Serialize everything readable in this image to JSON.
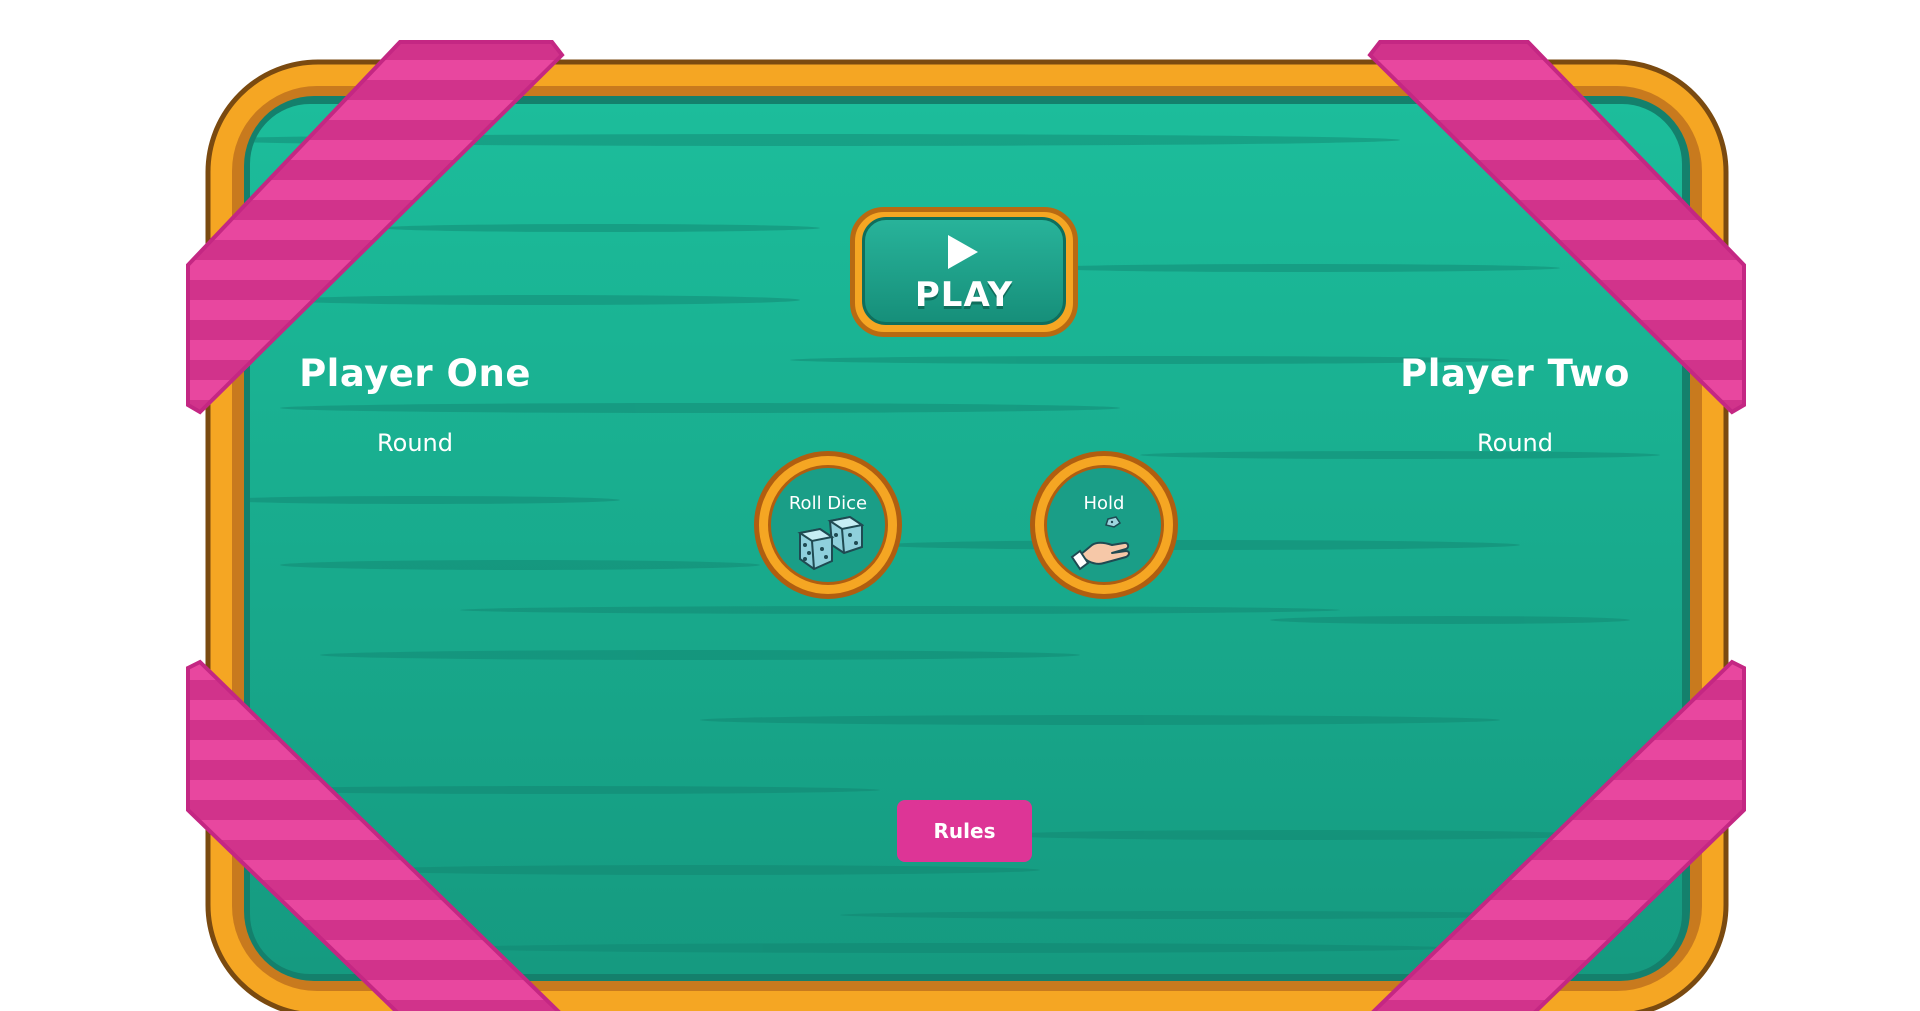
{
  "players": [
    {
      "name": "Player One",
      "round_label": "Round"
    },
    {
      "name": "Player Two",
      "round_label": "Round"
    }
  ],
  "controls": {
    "play_label": "PLAY",
    "roll_label": "Roll Dice",
    "hold_label": "Hold",
    "rules_label": "Rules"
  },
  "icons": {
    "play": "play-icon",
    "roll": "dice-icon",
    "hold": "hand-icon"
  },
  "colors": {
    "board_green": "#1aa88e",
    "frame_orange": "#f5a623",
    "ribbon_pink": "#dd3596",
    "text": "#ffffff"
  }
}
